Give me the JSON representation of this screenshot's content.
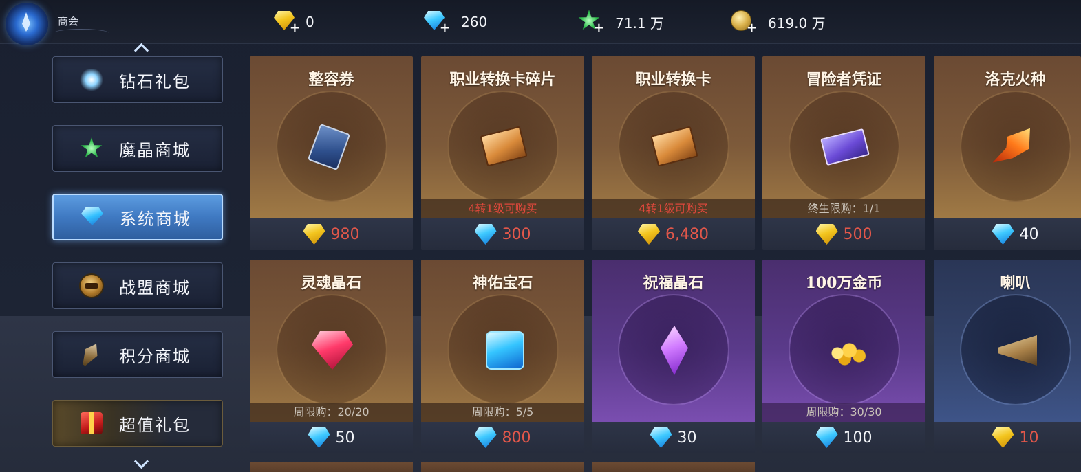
{
  "header": {
    "guild_label": "商会",
    "currencies": [
      {
        "icon": "gold-diamond-icon",
        "value": "0"
      },
      {
        "icon": "blue-diamond-icon",
        "value": "260"
      },
      {
        "icon": "green-crystal-icon",
        "value": "71.1 万"
      },
      {
        "icon": "gold-coin-icon",
        "value": "619.0 万"
      }
    ]
  },
  "sidebar": {
    "items": [
      {
        "label": "钻石礼包",
        "icon": "sparkle-diamond-icon",
        "active": false
      },
      {
        "label": "魔晶商城",
        "icon": "green-crystal-icon",
        "active": false
      },
      {
        "label": "系统商城",
        "icon": "blue-diamond-icon",
        "active": true
      },
      {
        "label": "战盟商城",
        "icon": "guild-badge-icon",
        "active": false
      },
      {
        "label": "积分商城",
        "icon": "feather-icon",
        "active": false
      },
      {
        "label": "超值礼包",
        "icon": "gift-icon",
        "active": false
      }
    ]
  },
  "shop": {
    "items": [
      {
        "name": "整容券",
        "limit": "",
        "currency": "gold",
        "price": "980",
        "price_red": true,
        "theme": "brown",
        "art": "portrait-card-icon"
      },
      {
        "name": "职业转换卡碎片",
        "limit": "4转1级可购买",
        "limit_red": true,
        "currency": "blue",
        "price": "300",
        "price_red": true,
        "theme": "brown",
        "art": "class-card-fragment-icon"
      },
      {
        "name": "职业转换卡",
        "limit": "4转1级可购买",
        "limit_red": true,
        "currency": "gold",
        "price": "6,480",
        "price_red": true,
        "theme": "brown",
        "art": "class-card-icon"
      },
      {
        "name": "冒险者凭证",
        "limit": "终生限购：1/1",
        "limit_red": false,
        "currency": "gold",
        "price": "500",
        "price_red": true,
        "theme": "brown",
        "art": "adventurer-ticket-icon"
      },
      {
        "name": "洛克火种",
        "limit": "",
        "currency": "blue",
        "price": "40",
        "price_red": false,
        "theme": "brown",
        "art": "fire-feather-icon"
      },
      {
        "name": "灵魂晶石",
        "limit": "周限购：20/20",
        "limit_red": false,
        "currency": "blue",
        "price": "50",
        "price_red": false,
        "theme": "brown",
        "art": "ruby-icon"
      },
      {
        "name": "神佑宝石",
        "limit": "周限购：5/5",
        "limit_red": false,
        "currency": "blue",
        "price": "800",
        "price_red": true,
        "theme": "brown",
        "art": "sapphire-icon"
      },
      {
        "name": "祝福晶石",
        "limit": "",
        "currency": "blue",
        "price": "30",
        "price_red": false,
        "theme": "purple",
        "art": "purple-crystal-icon"
      },
      {
        "name": "100万金币",
        "limit": "周限购：30/30",
        "limit_red": false,
        "currency": "blue",
        "price": "100",
        "price_red": false,
        "theme": "purple",
        "art": "gold-coins-icon"
      },
      {
        "name": "喇叭",
        "limit": "",
        "currency": "gold",
        "price": "10",
        "price_red": true,
        "theme": "navy",
        "art": "horn-icon"
      }
    ]
  },
  "colors": {
    "price_red": "#e2574a",
    "limit_red": "#e0483c",
    "active_tab": "#4a86d0"
  }
}
